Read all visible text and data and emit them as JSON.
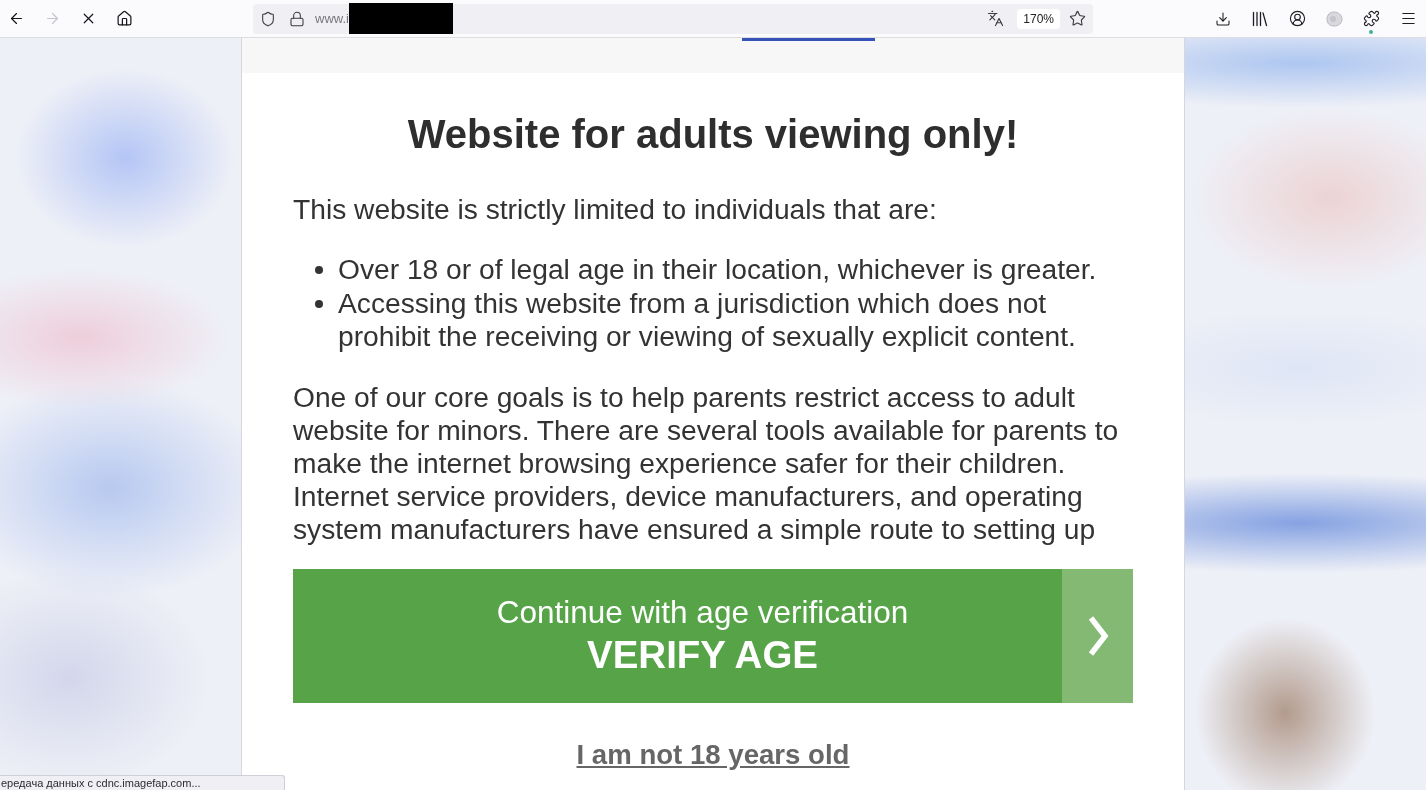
{
  "browser": {
    "nav_buttons": [
      {
        "kind": "back",
        "disabled": false
      },
      {
        "kind": "forward",
        "disabled": true
      },
      {
        "kind": "stop",
        "disabled": false
      },
      {
        "kind": "home",
        "disabled": false
      }
    ],
    "address_bar": {
      "url": "www.i",
      "redacted": true,
      "zoom": "170%"
    },
    "status_text": "ередача данных с cdnc.imagefap.com..."
  },
  "page": {
    "title": "Website for adults viewing only!",
    "intro": "This website is strictly limited to individuals that are:",
    "requirements": [
      "Over 18 or of legal age in their location, whichever is greater.",
      "Accessing this website from a jurisdiction which does not prohibit the receiving or viewing of sexually explicit content."
    ],
    "body": "One of our core goals is to help parents restrict access to adult website for minors. There are several tools available for parents to make the internet browsing experience safer for their children. Internet service providers, device manufacturers, and operating system manufacturers have ensured a simple route to setting up",
    "verify_button": {
      "caption": "Continue with age verification",
      "label": "VERIFY AGE"
    },
    "decline_link": "I am not 18 years old"
  }
}
